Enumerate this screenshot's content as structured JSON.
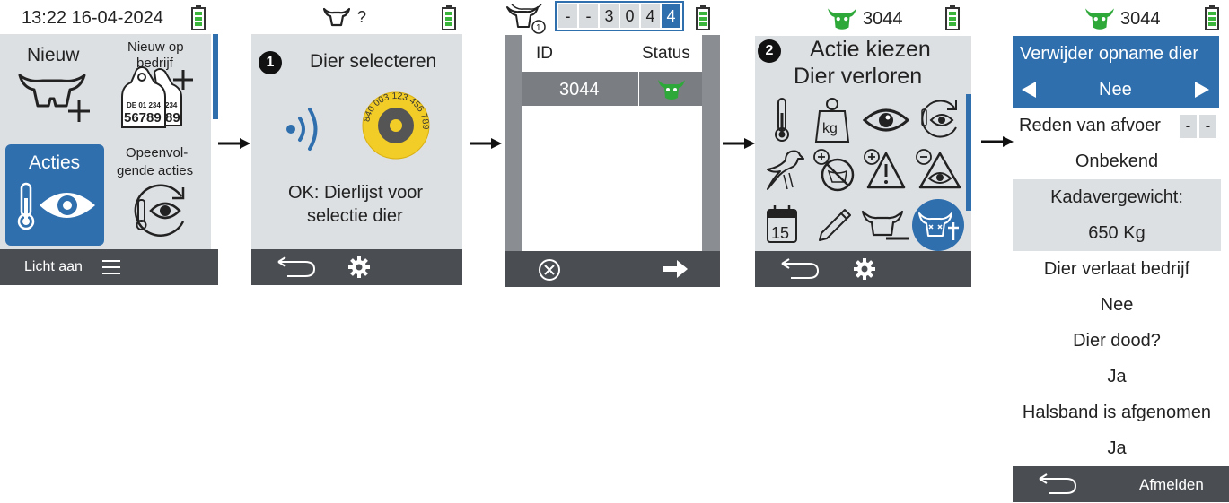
{
  "screen1": {
    "status_time": "13:22 16-04-2024",
    "tile_nieuw": "Nieuw",
    "tile_nieuw_op_bedrijf": [
      "Nieuw op",
      "bedrijf"
    ],
    "ear_tag_text": [
      "DE 01 234",
      "56789",
      "234",
      "89"
    ],
    "tile_acties": "Acties",
    "tile_opeenvolgende": [
      "Opeenvol-",
      "gende acties"
    ],
    "footer_label": "Licht aan"
  },
  "screen2": {
    "header_suffix": "?",
    "step_number": "1",
    "title": "Dier selecteren",
    "tag_numbers": "840 003 123 456 789",
    "hint": [
      "OK: Dierlijst voor",
      "selectie dier"
    ]
  },
  "screen3": {
    "header_badge": "1",
    "id_digits": [
      "-",
      "-",
      "3",
      "0",
      "4",
      "4"
    ],
    "col_id": "ID",
    "col_status": "Status",
    "row_id": "3044"
  },
  "screen4": {
    "header_id": "3044",
    "step_number": "2",
    "title": [
      "Actie kiezen",
      "Dier verloren"
    ],
    "scale_label": "kg",
    "calendar_day": "15"
  },
  "screen5": {
    "header_id": "3044",
    "title": "Verwijder opname dier",
    "selector_value": "Nee",
    "reason_label": "Reden van afvoer",
    "reason_dashes": [
      "-",
      "-"
    ],
    "rows": [
      "Onbekend",
      "Kadavergewicht:",
      "650 Kg",
      "Dier verlaat bedrijf",
      "Nee",
      "Dier dood?",
      "Ja",
      "Halsband is afgenomen",
      "Ja"
    ],
    "footer_logout": "Afmelden"
  },
  "colors": {
    "accent_blue": "#2f6fae",
    "panel_bg": "#dde0e3",
    "footer_bar": "#4a4d52",
    "battery_green": "#3bb43b",
    "cow_green": "#2fa83a",
    "tag_yellow": "#f2cc27"
  }
}
